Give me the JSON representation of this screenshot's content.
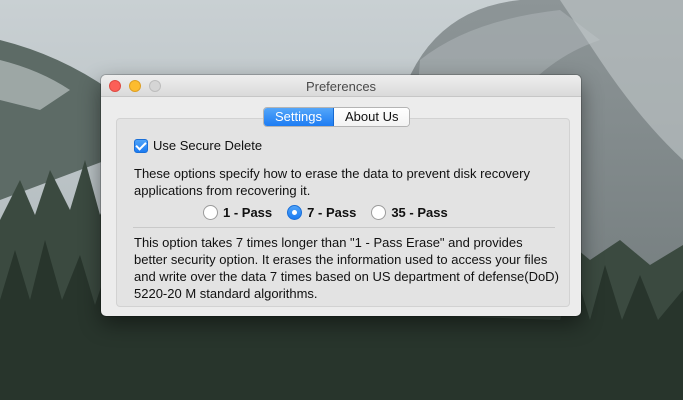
{
  "window": {
    "title": "Preferences"
  },
  "tabs": [
    {
      "label": "Settings",
      "active": true
    },
    {
      "label": "About Us",
      "active": false
    }
  ],
  "settings": {
    "secure_delete_label": "Use Secure Delete",
    "secure_delete_checked": true,
    "options_description": "These options specify how to erase the data to prevent disk recovery applications from recovering it.",
    "pass_options": [
      {
        "label": "1 - Pass",
        "selected": false
      },
      {
        "label": "7 - Pass",
        "selected": true
      },
      {
        "label": "35 - Pass",
        "selected": false
      }
    ],
    "selected_option_description": "This option takes 7 times longer than \"1 - Pass Erase\" and provides better security option. It erases the information used to access your files and write over the data 7 times based on US department of defense(DoD) 5220-20 M standard algorithms."
  },
  "colors": {
    "accent": "#1d7cf3",
    "close": "#fc5f57",
    "minimize": "#fdbc2e",
    "zoom_disabled": "#d5d5d5"
  }
}
